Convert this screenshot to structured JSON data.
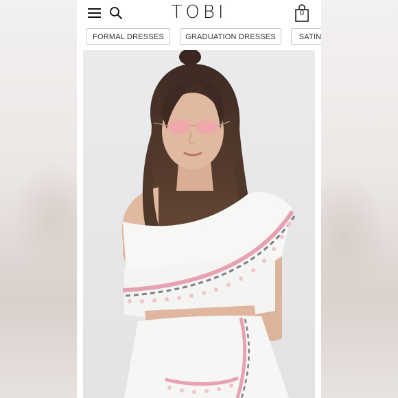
{
  "header": {
    "logo": "TOBI",
    "cart_count": "0",
    "icons": {
      "menu": "hamburger-menu-icon",
      "search": "search-icon",
      "cart": "shopping-bag-icon"
    }
  },
  "category_chips": [
    {
      "label": "FORMAL DRESSES"
    },
    {
      "label": "GRADUATION DRESSES"
    },
    {
      "label": "SATIN"
    }
  ],
  "product_image": {
    "colors": {
      "background": "#e8e8ea",
      "top": "#f7f7f5",
      "trim_pink": "#e7a1b3",
      "trim_grey": "#7d7f86",
      "hair": "#4a3328",
      "skin": "#e1b9a1",
      "lens": "#f2a3ad"
    }
  },
  "theme": {
    "accent": "#111111",
    "chip_border": "#c9c9c9",
    "page_bg": "#ffffff"
  }
}
